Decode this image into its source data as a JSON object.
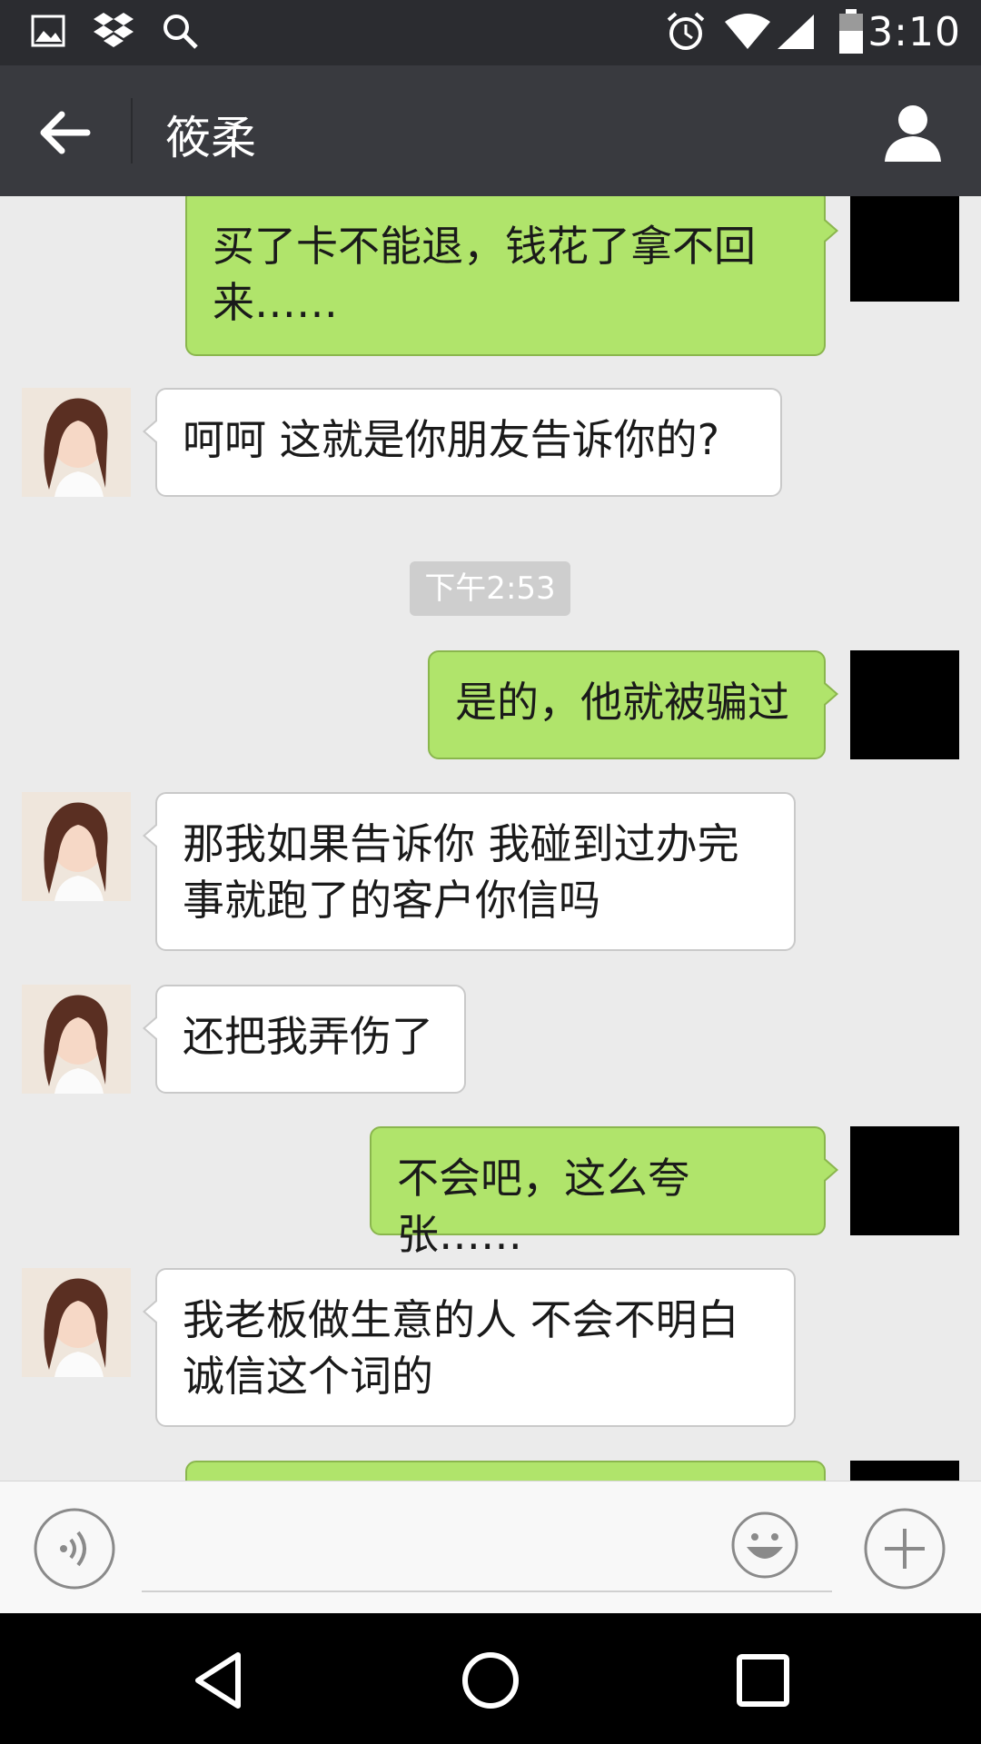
{
  "status_bar": {
    "time": "3:10",
    "left_icons": [
      "image-icon",
      "dropbox-icon",
      "search-icon"
    ],
    "right_icons": [
      "alarm-icon",
      "wifi-icon",
      "cell-signal-icon",
      "battery-icon"
    ]
  },
  "header": {
    "title": "筱柔",
    "back_icon": "arrow-left-icon",
    "profile_icon": "person-icon"
  },
  "messages": [
    {
      "side": "out",
      "text": "买了卡不能退，钱花了拿不回来……"
    },
    {
      "side": "in",
      "text": "呵呵 这就是你朋友告诉你的?"
    },
    {
      "side": "out",
      "text": "是的，他就被骗过"
    },
    {
      "side": "in",
      "text": "那我如果告诉你 我碰到过办完事就跑了的客户你信吗"
    },
    {
      "side": "in",
      "text": "还把我弄伤了"
    },
    {
      "side": "out",
      "text": "不会吧，这么夸张……"
    },
    {
      "side": "in",
      "text": "我老板做生意的人 不会不明白诚信这个词的"
    },
    {
      "side": "out",
      "text": ""
    }
  ],
  "timestamp": "下午2:53",
  "input_bar": {
    "placeholder": "",
    "voice_icon": "voice-icon",
    "emoji_icon": "smiley-icon",
    "plus_icon": "plus-icon"
  },
  "colors": {
    "outgoing_bubble": "#b0e46b",
    "incoming_bubble": "#ffffff",
    "chat_background": "#ebebeb",
    "title_bar": "#393a3f",
    "status_bar": "#2b2c30"
  }
}
